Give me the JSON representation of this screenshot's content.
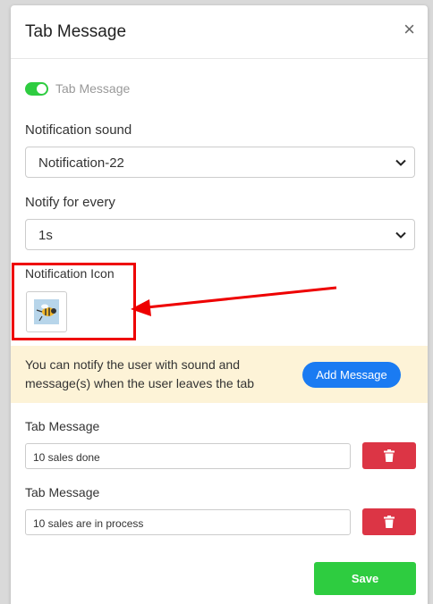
{
  "modal": {
    "title": "Tab Message",
    "close_icon": "close-icon"
  },
  "toggle": {
    "label": "Tab Message",
    "enabled": true,
    "color": "#2ecc40"
  },
  "notification_sound": {
    "label": "Notification sound",
    "value": "Notification-22"
  },
  "notify_every": {
    "label": "Notify for every",
    "value": "1s"
  },
  "notification_icon": {
    "label": "Notification Icon",
    "icon": "bee-image"
  },
  "info": {
    "text": "You can notify the user with sound and message(s) when the user leaves the tab",
    "add_button": "Add Message",
    "background": "#fdf3d7",
    "button_color": "#1a7bf2"
  },
  "messages": [
    {
      "label": "Tab Message",
      "value": "10 sales done",
      "delete_icon": "trash-icon"
    },
    {
      "label": "Tab Message",
      "value": "10 sales are in process",
      "delete_icon": "trash-icon"
    }
  ],
  "footer": {
    "save_label": "Save",
    "save_color": "#2ecc40",
    "delete_color": "#dc3545"
  }
}
